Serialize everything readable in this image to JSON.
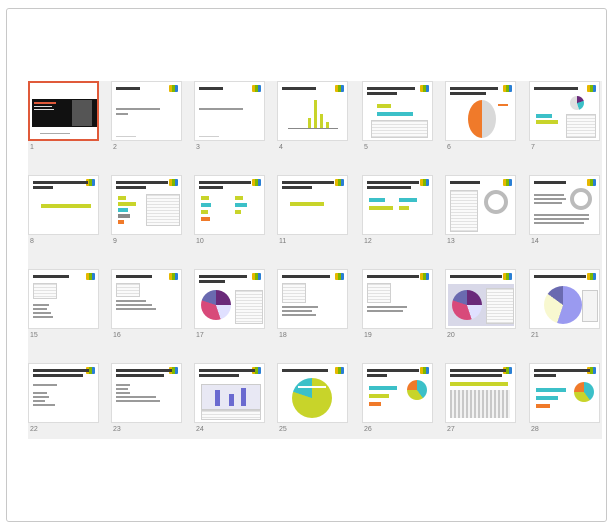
{
  "slides": [
    {
      "n": "1"
    },
    {
      "n": "2"
    },
    {
      "n": "3"
    },
    {
      "n": "4"
    },
    {
      "n": "5"
    },
    {
      "n": "6"
    },
    {
      "n": "7"
    },
    {
      "n": "8"
    },
    {
      "n": "9"
    },
    {
      "n": "10"
    },
    {
      "n": "11"
    },
    {
      "n": "12"
    },
    {
      "n": "13"
    },
    {
      "n": "14"
    },
    {
      "n": "15"
    },
    {
      "n": "16"
    },
    {
      "n": "17"
    },
    {
      "n": "18"
    },
    {
      "n": "19"
    },
    {
      "n": "20"
    },
    {
      "n": "21"
    },
    {
      "n": "22"
    },
    {
      "n": "23"
    },
    {
      "n": "24"
    },
    {
      "n": "25"
    },
    {
      "n": "26"
    },
    {
      "n": "27"
    },
    {
      "n": "28"
    }
  ],
  "colors": {
    "accent": "#e05a3a",
    "lime": "#c8d42a",
    "teal": "#3cc0c8",
    "orange": "#f07a2a",
    "purple": "#6a2a7a"
  }
}
